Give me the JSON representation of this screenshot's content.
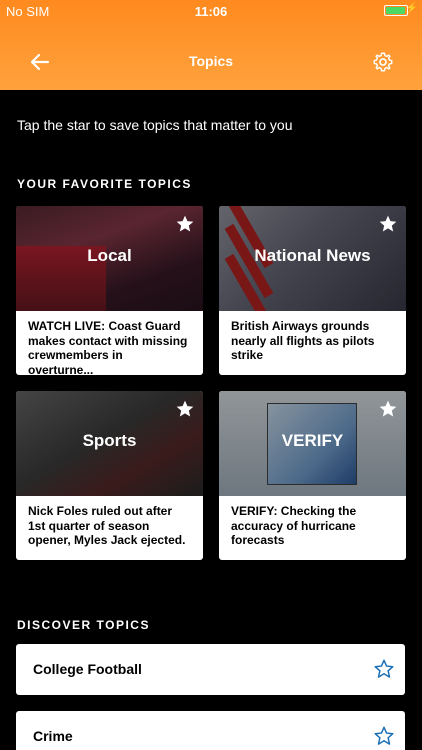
{
  "status_bar": {
    "carrier": "No SIM",
    "time": "11:06",
    "battery_color": "#4cd964"
  },
  "header": {
    "title": "Topics",
    "back_icon": "arrow-left-icon",
    "settings_icon": "gear-icon",
    "gradient": [
      "#ff8a1f",
      "#ffa23c"
    ]
  },
  "intro_text": "Tap the star to save topics that matter to you",
  "favorites": {
    "title": "YOUR FAVORITE TOPICS",
    "cards": [
      {
        "label": "Local",
        "headline": "WATCH LIVE: Coast Guard makes contact with missing crewmembers in overturne..."
      },
      {
        "label": "National News",
        "headline": "British Airways grounds nearly all flights as pilots strike"
      },
      {
        "label": "Sports",
        "headline": "Nick Foles ruled out after 1st quarter of season opener, Myles Jack ejected."
      },
      {
        "label": "VERIFY",
        "headline": "VERIFY: Checking the accuracy of hurricane forecasts"
      }
    ]
  },
  "discover": {
    "title": "DISCOVER TOPICS",
    "items": [
      {
        "label": "College Football"
      },
      {
        "label": "Crime"
      }
    ],
    "star_color": "#1a6fb5"
  }
}
